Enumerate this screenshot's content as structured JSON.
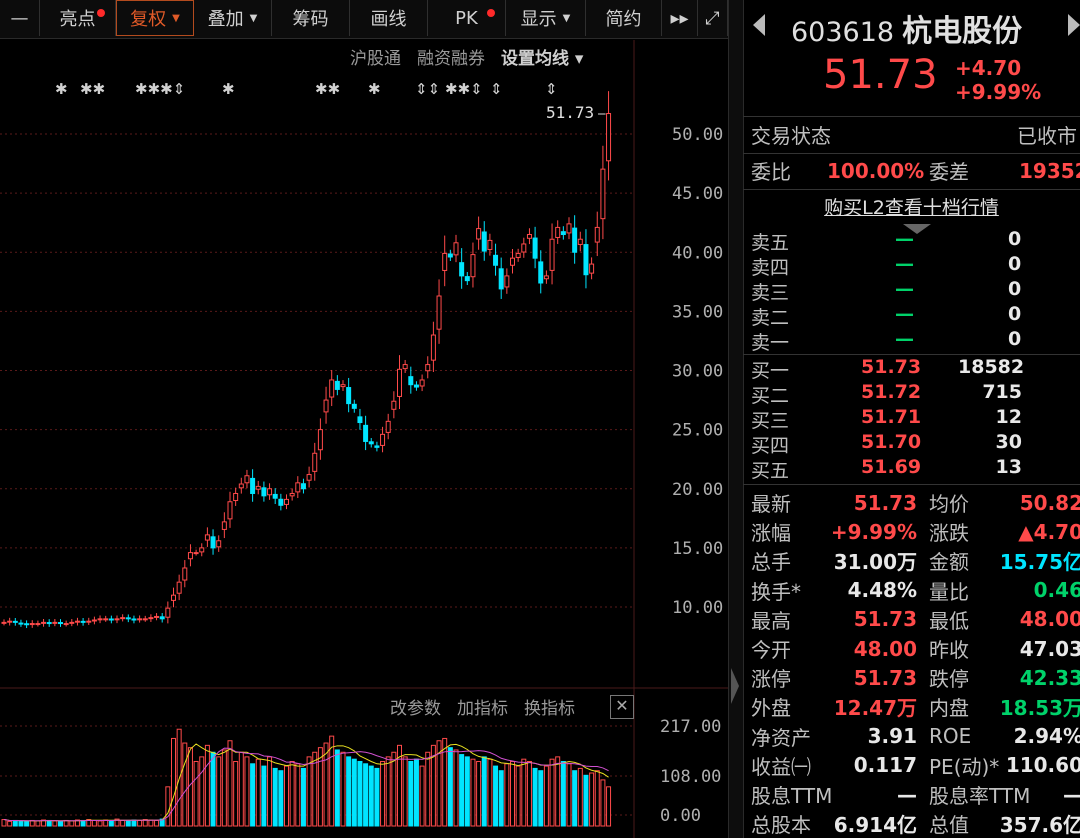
{
  "toolbar": {
    "items": [
      {
        "label": "—",
        "dot": false,
        "caret": false,
        "active": false,
        "w": 40
      },
      {
        "label": "亮点",
        "dot": true,
        "caret": false,
        "active": false,
        "w": 76
      },
      {
        "label": "复权",
        "dot": false,
        "caret": true,
        "active": true,
        "w": 78
      },
      {
        "label": "叠加",
        "dot": false,
        "caret": true,
        "active": false,
        "w": 78
      },
      {
        "label": "筹码",
        "dot": false,
        "caret": false,
        "active": false,
        "w": 78
      },
      {
        "label": "画线",
        "dot": false,
        "caret": false,
        "active": false,
        "w": 78
      },
      {
        "label": "PK",
        "dot": true,
        "caret": false,
        "active": false,
        "w": 78
      },
      {
        "label": "显示",
        "dot": false,
        "caret": true,
        "active": false,
        "w": 80
      },
      {
        "label": "简约",
        "dot": false,
        "caret": false,
        "active": false,
        "w": 76
      },
      {
        "label": "▸▸",
        "dot": false,
        "caret": false,
        "active": false,
        "w": 36
      },
      {
        "label": "⤢",
        "dot": false,
        "caret": false,
        "active": false,
        "w": 30
      }
    ]
  },
  "subbar": {
    "item1": "沪股通",
    "item2": "融资融券",
    "item3": "设置均线 ▾"
  },
  "price_axis": [
    "50.00",
    "45.00",
    "40.00",
    "35.00",
    "30.00",
    "25.00",
    "20.00",
    "15.00",
    "10.00"
  ],
  "last_price_label": "51.73",
  "marker_row": [
    "✱",
    "✱✱",
    "✱✱✱⇕",
    "✱",
    "✱✱",
    "✱",
    "⇕⇕",
    "✱✱⇕",
    "⇕",
    "⇕"
  ],
  "vol_tools": {
    "a": "改参数",
    "b": "加指标",
    "c": "换指标",
    "close": "✕"
  },
  "vol_axis": [
    "217.00",
    "108.00",
    "0.00"
  ],
  "chart_data": {
    "type": "candlestick",
    "ylim": [
      5,
      53
    ],
    "closes": [
      8.7,
      8.8,
      8.7,
      8.6,
      8.5,
      8.6,
      8.6,
      8.7,
      8.6,
      8.7,
      8.6,
      8.6,
      8.7,
      8.8,
      8.7,
      8.8,
      8.9,
      9.0,
      9.0,
      8.9,
      9.0,
      9.1,
      9.0,
      8.9,
      9.0,
      9.0,
      9.1,
      9.2,
      9.0,
      9.9,
      11.0,
      12.1,
      13.3,
      14.6,
      14.6,
      15.0,
      16.1,
      15.0,
      15.6,
      17.2,
      18.9,
      19.6,
      20.4,
      21.1,
      19.6,
      20.2,
      19.4,
      20.0,
      19.2,
      18.6,
      19.1,
      19.6,
      20.5,
      20.0,
      21.2,
      23.0,
      25.0,
      27.5,
      29.2,
      28.4,
      28.8,
      27.2,
      26.8,
      25.6,
      24.0,
      23.8,
      23.5,
      24.6,
      25.7,
      27.4,
      30.1,
      30.5,
      28.8,
      28.6,
      29.2,
      30.5,
      33.0,
      36.3,
      39.9,
      39.6,
      40.8,
      38.0,
      37.6,
      39.8,
      42.0,
      40.1,
      41.0,
      38.9,
      36.9,
      38.0,
      39.5,
      39.9,
      40.7,
      41.5,
      39.5,
      37.4,
      38.0,
      41.1,
      42.1,
      41.5,
      42.4,
      40.0,
      41.1,
      38.1,
      39.0,
      42.1,
      47.03,
      51.73
    ],
    "volumes": [
      14,
      10,
      12,
      11,
      10,
      12,
      11,
      13,
      12,
      11,
      10,
      12,
      11,
      13,
      12,
      14,
      12,
      11,
      13,
      12,
      15,
      12,
      11,
      13,
      12,
      14,
      13,
      12,
      15,
      85,
      190,
      210,
      180,
      170,
      140,
      150,
      175,
      160,
      150,
      165,
      185,
      140,
      160,
      150,
      135,
      145,
      130,
      150,
      125,
      120,
      130,
      140,
      135,
      125,
      150,
      160,
      170,
      180,
      195,
      165,
      160,
      150,
      145,
      140,
      135,
      130,
      125,
      140,
      150,
      160,
      175,
      150,
      140,
      145,
      130,
      160,
      175,
      185,
      190,
      170,
      165,
      155,
      150,
      145,
      140,
      150,
      145,
      130,
      120,
      135,
      140,
      130,
      145,
      140,
      125,
      120,
      130,
      145,
      150,
      140,
      135,
      120,
      125,
      110,
      115,
      120,
      100,
      85
    ],
    "y_unit": "price"
  },
  "header": {
    "code": "603618",
    "name": "杭电股份"
  },
  "quote": {
    "price": "51.73",
    "change": "+4.70",
    "pct": "+9.99%"
  },
  "status": {
    "label": "交易状态",
    "value": "已收市"
  },
  "weibi": {
    "l1": "委比",
    "v1": "100.00%",
    "l2": "委差",
    "v2": "19352"
  },
  "l2_link": "购买L2查看十档行情",
  "sell": [
    {
      "label": "卖五",
      "price": "—",
      "vol": "0"
    },
    {
      "label": "卖四",
      "price": "—",
      "vol": "0"
    },
    {
      "label": "卖三",
      "price": "—",
      "vol": "0"
    },
    {
      "label": "卖二",
      "price": "—",
      "vol": "0"
    },
    {
      "label": "卖一",
      "price": "—",
      "vol": "0"
    }
  ],
  "buy": [
    {
      "label": "买一",
      "price": "51.73",
      "vol": "18582"
    },
    {
      "label": "买二",
      "price": "51.72",
      "vol": "715"
    },
    {
      "label": "买三",
      "price": "51.71",
      "vol": "12"
    },
    {
      "label": "买四",
      "price": "51.70",
      "vol": "30"
    },
    {
      "label": "买五",
      "price": "51.69",
      "vol": "13"
    }
  ],
  "stats": [
    {
      "l1": "最新",
      "v1": "51.73",
      "c1": "red",
      "l2": "均价",
      "v2": "50.82",
      "c2": "red"
    },
    {
      "l1": "涨幅",
      "v1": "+9.99%",
      "c1": "red",
      "l2": "涨跌",
      "v2": "▲4.70",
      "c2": "red"
    },
    {
      "l1": "总手",
      "v1": "31.00万",
      "c1": "white",
      "l2": "金额",
      "v2": "15.75亿",
      "c2": "cyan"
    },
    {
      "l1": "换手*",
      "v1": "4.48%",
      "c1": "white",
      "l2": "量比",
      "v2": "0.46",
      "c2": "green"
    },
    {
      "l1": "最高",
      "v1": "51.73",
      "c1": "red",
      "l2": "最低",
      "v2": "48.00",
      "c2": "red"
    },
    {
      "l1": "今开",
      "v1": "48.00",
      "c1": "red",
      "l2": "昨收",
      "v2": "47.03",
      "c2": "white"
    },
    {
      "l1": "涨停",
      "v1": "51.73",
      "c1": "red",
      "l2": "跌停",
      "v2": "42.33",
      "c2": "green"
    },
    {
      "l1": "外盘",
      "v1": "12.47万",
      "c1": "red",
      "l2": "内盘",
      "v2": "18.53万",
      "c2": "green"
    },
    {
      "l1": "净资产",
      "v1": "3.91",
      "c1": "white",
      "l2": "ROE",
      "v2": "2.94%",
      "c2": "white"
    },
    {
      "l1": "收益㈠",
      "v1": "0.117",
      "c1": "white",
      "l2": "PE(动)*",
      "v2": "110.60",
      "c2": "white"
    },
    {
      "l1": "股息TTM",
      "v1": "—",
      "c1": "white",
      "l2": "股息率TTM",
      "v2": "—",
      "c2": "white"
    },
    {
      "l1": "总股本",
      "v1": "6.914亿",
      "c1": "white",
      "l2": "总值",
      "v2": "357.6亿",
      "c2": "white"
    }
  ],
  "colors": {
    "up": "#ff4a4a",
    "down": "#00e5ff",
    "grid": "#5a1a1a"
  }
}
